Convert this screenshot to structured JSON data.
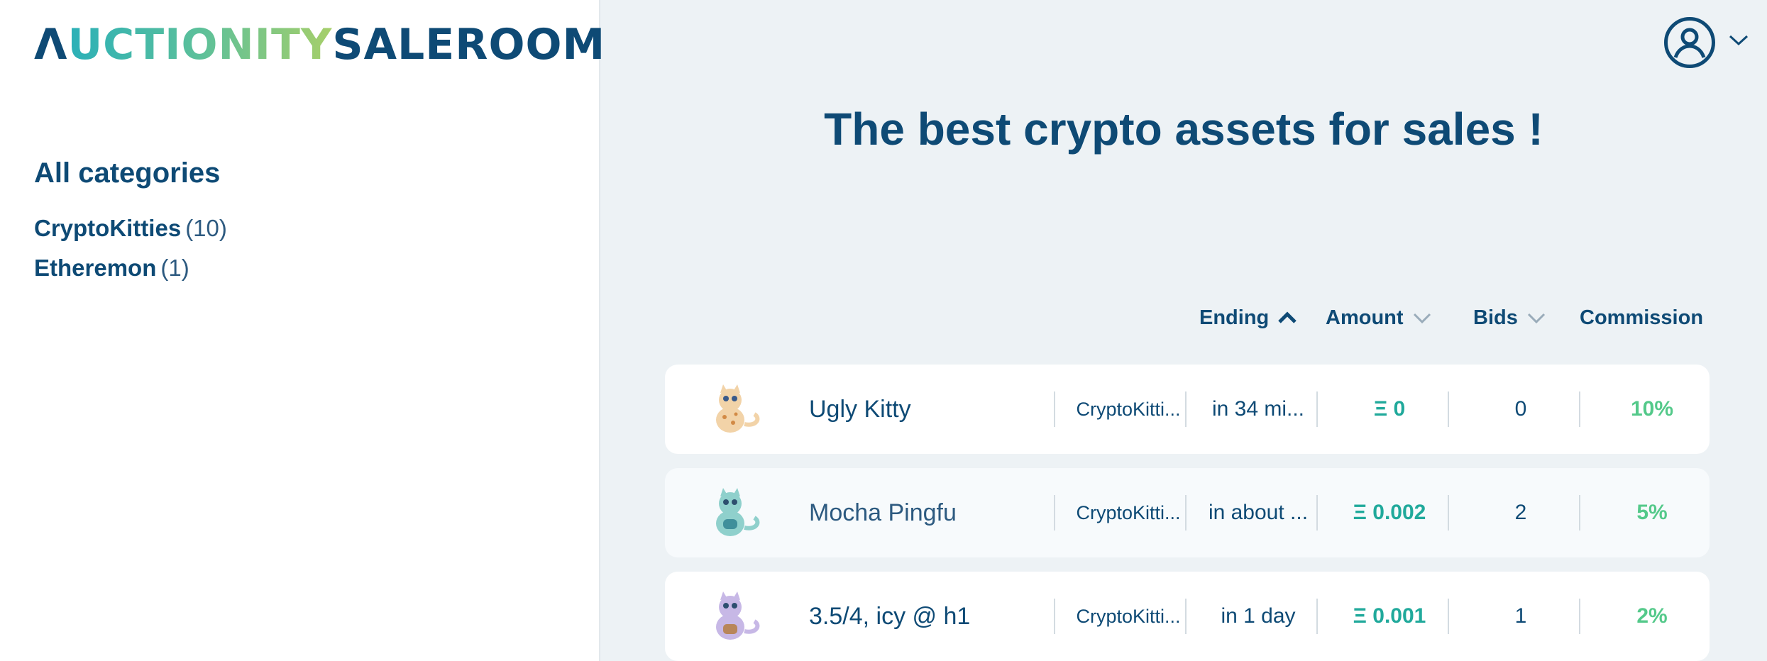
{
  "brand": {
    "logo_part1": "Λ",
    "logo_part2": "UCTIONITY",
    "logo_part3": "SALEROOM"
  },
  "sidebar": {
    "heading": "All categories",
    "categories": [
      {
        "name": "CryptoKitties",
        "count": "(10)"
      },
      {
        "name": "Etheremon",
        "count": "(1)"
      }
    ]
  },
  "header": {
    "user_icon": "user-circle-icon",
    "dropdown_icon": "chevron-down-icon"
  },
  "main": {
    "hero_title": "The best crypto assets for sales !",
    "sort_headers": [
      {
        "label": "Ending",
        "icon": "chevron-up-icon",
        "active": true
      },
      {
        "label": "Amount",
        "icon": "chevron-down-icon",
        "active": false
      },
      {
        "label": "Bids",
        "icon": "chevron-down-icon",
        "active": false
      },
      {
        "label": "Commission",
        "icon": "",
        "active": false
      }
    ],
    "auctions": [
      {
        "title": "Ugly Kitty",
        "category": "CryptoKitti...",
        "ending": "in 34 mi...",
        "amount": "Ξ 0",
        "bids": "0",
        "commission": "10%",
        "thumb_color": "#f2d3a8"
      },
      {
        "title": "Mocha Pingfu",
        "category": "CryptoKitti...",
        "ending": "in about ...",
        "amount": "Ξ 0.002",
        "bids": "2",
        "commission": "5%",
        "thumb_color": "#8fd0cc"
      },
      {
        "title": "3.5/4, icy @ h1",
        "category": "CryptoKitti...",
        "ending": "in 1 day",
        "amount": "Ξ 0.001",
        "bids": "1",
        "commission": "2%",
        "thumb_color": "#c7b8e6"
      }
    ]
  },
  "colors": {
    "primary": "#0e4a75",
    "amount": "#20a99b",
    "commission": "#54c98a",
    "background": "#edf2f5"
  }
}
